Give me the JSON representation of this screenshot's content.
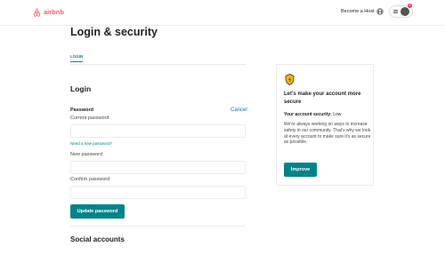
{
  "header": {
    "logo_text": "airbnb",
    "become_host": "Become a Host",
    "notification_count": "1",
    "colors": {
      "brand": "#ff5a5f",
      "badge": "#ff385c"
    }
  },
  "page": {
    "title": "Login & security"
  },
  "tabs": [
    {
      "label": "LOGIN",
      "active": true
    }
  ],
  "login": {
    "section_title": "Login",
    "password_label": "Password",
    "cancel_label": "Cancel",
    "current_password_label": "Current password",
    "current_password_value": "",
    "need_new_password": "Need a new password?",
    "new_password_label": "New password",
    "new_password_value": "",
    "confirm_password_label": "Confirm password",
    "confirm_password_value": "",
    "update_button": "Update password"
  },
  "social": {
    "title": "Social accounts"
  },
  "security_card": {
    "title": "Let's make your account more secure",
    "security_label": "Your account security:",
    "security_level": "Low",
    "description": "We're always working on ways to increase safety in our community. That's why we look at every account to make sure it's as secure as possible.",
    "improve_button": "Improve",
    "icon": "shield-icon"
  },
  "colors": {
    "accent": "#008489",
    "text": "#222222",
    "border": "#ebebeb"
  }
}
